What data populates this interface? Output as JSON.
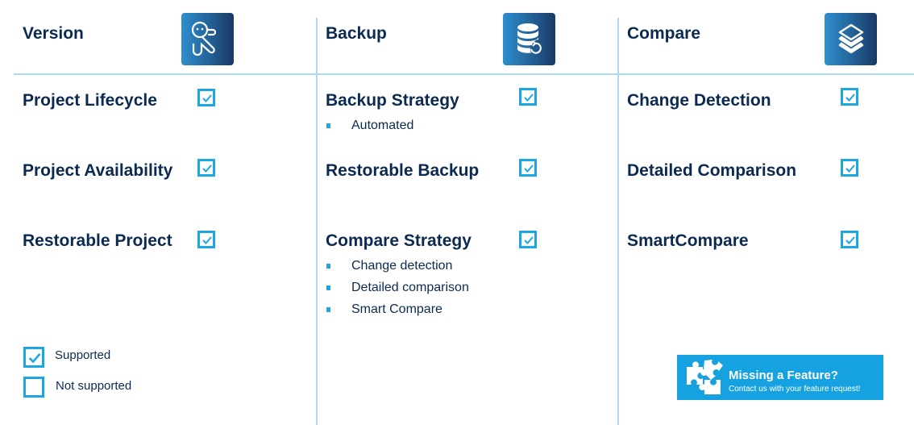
{
  "columns": [
    {
      "title": "Version",
      "icon": "octopus-logo-icon",
      "features": [
        {
          "label": "Project Lifecycle",
          "supported": true,
          "details": []
        },
        {
          "label": "Project Availability",
          "supported": true,
          "details": []
        },
        {
          "label": "Restorable Project",
          "supported": true,
          "details": []
        }
      ]
    },
    {
      "title": "Backup",
      "icon": "database-restore-icon",
      "features": [
        {
          "label": "Backup Strategy",
          "supported": true,
          "details": [
            "Automated"
          ]
        },
        {
          "label": "Restorable Backup",
          "supported": true,
          "details": []
        },
        {
          "label": "Compare Strategy",
          "supported": true,
          "details": [
            "Change detection",
            "Detailed comparison",
            "Smart Compare"
          ]
        }
      ]
    },
    {
      "title": "Compare",
      "icon": "layers-icon",
      "features": [
        {
          "label": "Change Detection",
          "supported": true,
          "details": []
        },
        {
          "label": "Detailed Comparison",
          "supported": true,
          "details": []
        },
        {
          "label": "SmartCompare",
          "supported": true,
          "details": []
        }
      ]
    }
  ],
  "legend": {
    "supported": "Supported",
    "not_supported": "Not supported"
  },
  "banner": {
    "title": "Missing a Feature?",
    "subtitle": "Contact us with your feature request!",
    "icon": "puzzle-icon"
  },
  "colors": {
    "accent": "#1aa7e4",
    "text": "#0b2a52",
    "divider": "#a9dcf3",
    "banner": "#16a2e0"
  }
}
